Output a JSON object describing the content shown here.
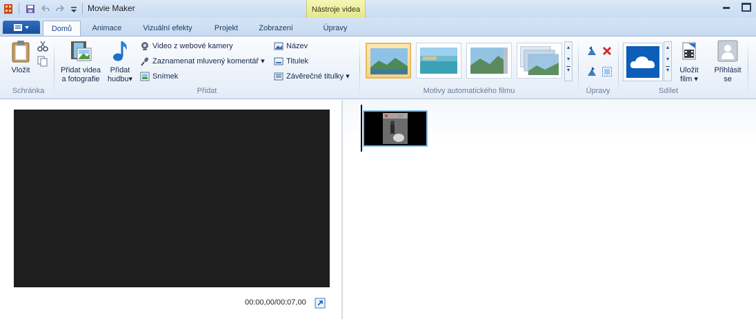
{
  "window": {
    "title": "Movie Maker",
    "contextual_tab_group": "Nástroje videa"
  },
  "tabs": [
    "Domů",
    "Animace",
    "Vizuální efekty",
    "Projekt",
    "Zobrazení",
    "Úpravy"
  ],
  "active_tab": "Domů",
  "ribbon": {
    "clipboard": {
      "paste_label": "Vložit",
      "group_label": "Schránka"
    },
    "add": {
      "add_videos_label": "Přidat videa a fotografie",
      "add_music_label": "Přidat hudbu",
      "webcam_label": "Video z webové kamery",
      "narration_label": "Zaznamenat mluvený komentář",
      "snapshot_label": "Snímek",
      "title_label": "Název",
      "caption_label": "Titulek",
      "credits_label": "Závěrečné titulky",
      "group_label": "Přidat"
    },
    "themes": {
      "group_label": "Motivy automatického filmu",
      "selected_index": 0
    },
    "editing": {
      "group_label": "Úpravy"
    },
    "share": {
      "group_label": "Sdílet",
      "save_movie_label": "Uložit film",
      "sign_in_label": "Přihlásit se"
    }
  },
  "player": {
    "time": "00:00,00/00:07,00"
  },
  "colors": {
    "accent": "#1b5fb0",
    "onedrive": "#0c5eb8",
    "selection": "#fbd37e"
  }
}
